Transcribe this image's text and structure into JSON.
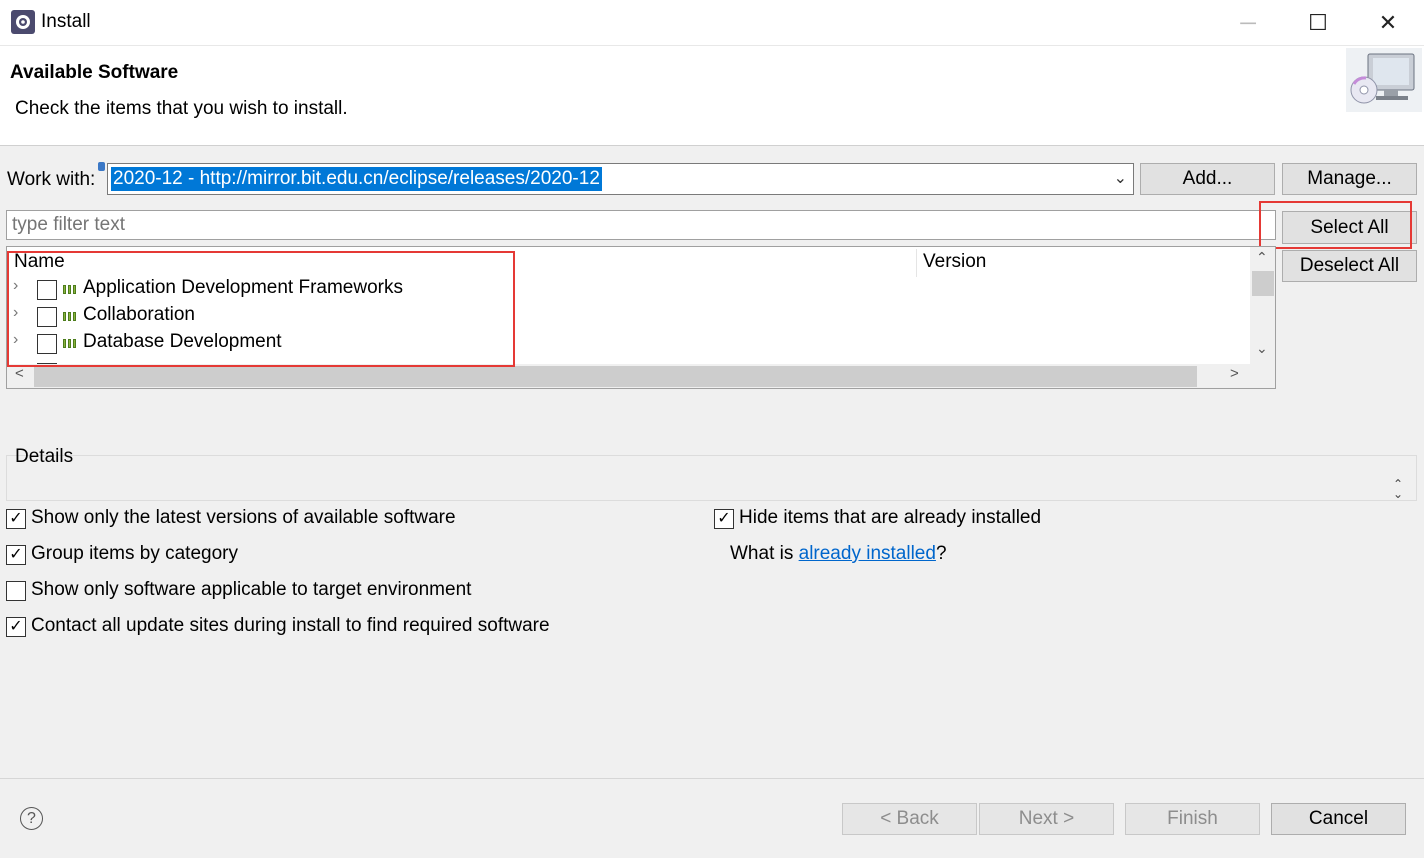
{
  "window": {
    "title": "Install",
    "icon": "eclipse-gear-icon",
    "controls": {
      "minimize": "─",
      "maximize": "☐",
      "close": "✕"
    }
  },
  "header": {
    "title": "Available Software",
    "description": "Check the items that you wish to install.",
    "banner_icon": "install-cd-monitor-icon"
  },
  "work_with": {
    "label": "Work with:",
    "value": "2020-12 - http://mirror.bit.edu.cn/eclipse/releases/2020-12",
    "add_label": "Add...",
    "manage_label": "Manage..."
  },
  "filter": {
    "placeholder": "type filter text"
  },
  "side_buttons": {
    "select_all": "Select All",
    "deselect_all": "Deselect All"
  },
  "tree": {
    "columns": [
      "Name",
      "Version"
    ],
    "items": [
      {
        "label": "Application Development Frameworks",
        "checked": false
      },
      {
        "label": "Collaboration",
        "checked": false
      },
      {
        "label": "Database Development",
        "checked": false
      }
    ]
  },
  "details": {
    "label": "Details"
  },
  "options": {
    "latest_versions": {
      "label": "Show only the latest versions of available software",
      "checked": true
    },
    "group_by_category": {
      "label": "Group items by category",
      "checked": true
    },
    "applicable_only": {
      "label": "Show only software applicable to target environment",
      "checked": false
    },
    "contact_update_sites": {
      "label": "Contact all update sites during install to find required software",
      "checked": true
    },
    "hide_installed": {
      "label": "Hide items that are already installed",
      "checked": true
    }
  },
  "installed_link": {
    "prefix": "What is ",
    "link": "already installed",
    "suffix": "?"
  },
  "footer": {
    "back": "< Back",
    "next": "Next >",
    "finish": "Finish",
    "cancel": "Cancel",
    "help_icon": "?"
  },
  "highlight_color": "#e53935"
}
